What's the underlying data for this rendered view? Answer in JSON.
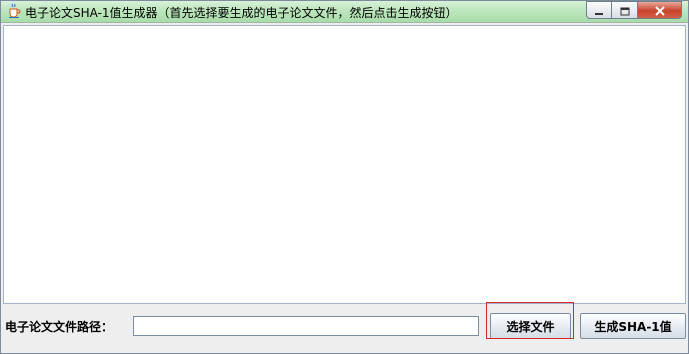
{
  "window": {
    "title": "电子论文SHA-1值生成器（首先选择要生成的电子论文文件，然后点击生成按钮）",
    "icon": "java-coffee-cup-icon",
    "controls": {
      "minimize_icon": "minimize-icon",
      "maximize_icon": "maximize-icon",
      "close_icon": "close-icon"
    }
  },
  "output": {
    "text": ""
  },
  "form": {
    "path_label": "电子论文文件路径：",
    "path_value": "",
    "path_placeholder": "",
    "choose_button": "选择文件",
    "generate_button": "生成SHA-1值"
  },
  "colors": {
    "titlebar": "#bfe7c0",
    "close_button": "#c7432c",
    "focus_highlight": "#d9262b",
    "background": "#eeeeee"
  }
}
